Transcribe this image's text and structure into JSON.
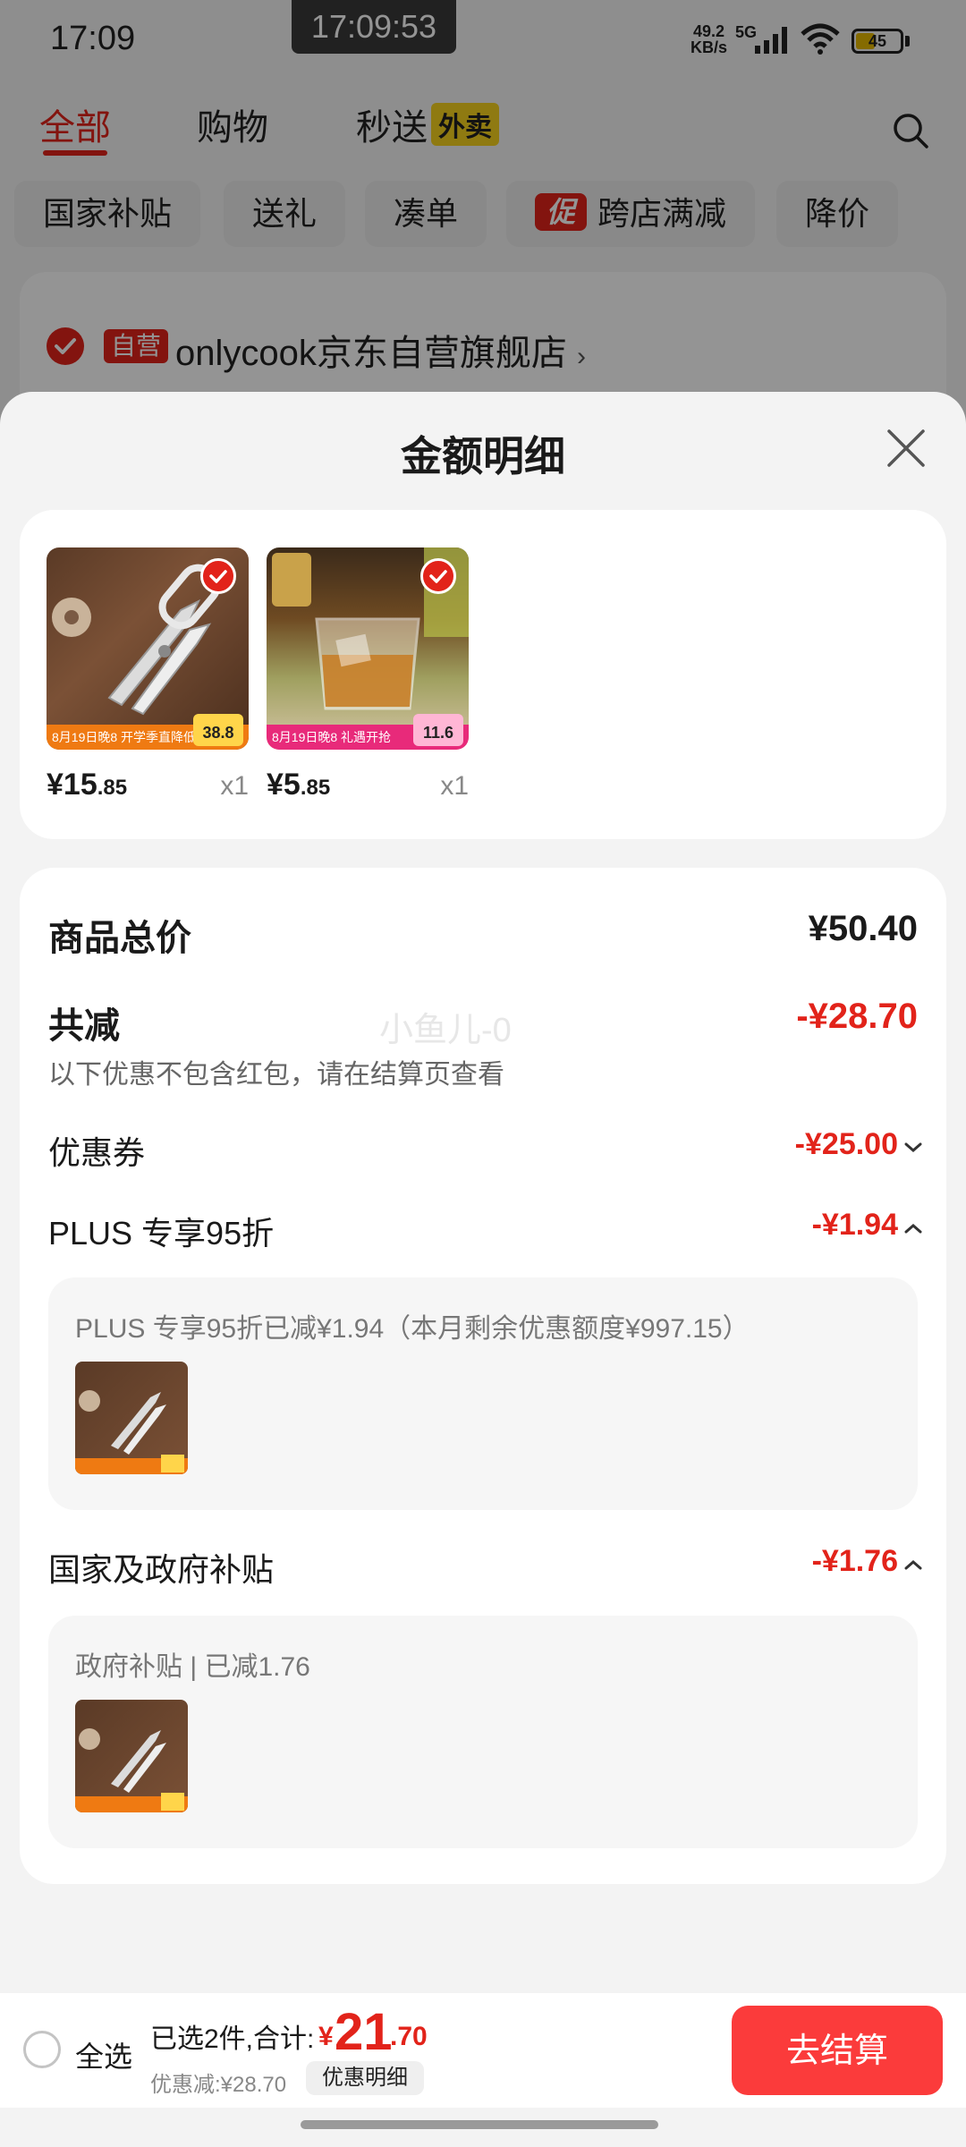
{
  "status_bar": {
    "time": "17:09",
    "clock": "17:09:53",
    "net_speed_value": "49.2",
    "net_speed_unit": "KB/s",
    "network": "5G",
    "battery": "45"
  },
  "top_tabs": {
    "all": "全部",
    "shopping": "购物",
    "instant": "秒送",
    "takeout_badge": "外卖"
  },
  "chips": [
    "国家补贴",
    "送礼",
    "凑单",
    "跨店满减",
    "降价"
  ],
  "chip_promo_badge": "促",
  "store": {
    "self_badge": "自营",
    "name": "onlycook京东自营旗舰店",
    "chevron": "›"
  },
  "sheet": {
    "title": "金额明细"
  },
  "products": [
    {
      "price_symbol": "¥",
      "price_int": "15",
      "price_dec": ".85",
      "qty": "x1",
      "promo_bar": "8月19日晚8 开学季直降低价",
      "tag_price": "38.8",
      "icon": "kitchen-scissors"
    },
    {
      "price_symbol": "¥",
      "price_int": "5",
      "price_dec": ".85",
      "qty": "x1",
      "promo_bar": "8月19日晚8 礼遇开抢",
      "tag_price": "11.6",
      "icon": "whisky-glass"
    }
  ],
  "details": {
    "total_label": "商品总价",
    "total_value": "¥50.40",
    "reduction_label": "共减",
    "reduction_value": "-¥28.70",
    "reduction_note": "以下优惠不包含红包，请在结算页查看",
    "coupon_label": "优惠券",
    "coupon_value": "-¥25.00",
    "plus_label": "PLUS 专享95折",
    "plus_value": "-¥1.94",
    "plus_desc": "PLUS 专享95折已减¥1.94（本月剩余优惠额度¥997.15）",
    "gov_label": "国家及政府补贴",
    "gov_value": "-¥1.76",
    "gov_desc": "政府补贴 | 已减1.76"
  },
  "watermark": "小鱼儿-0",
  "bottom_bar": {
    "select_all": "全选",
    "selected_summary": "已选2件,合计:",
    "total_symbol": "¥",
    "total_int": "21",
    "total_dec": ".70",
    "discount_summary": "优惠减:¥28.70",
    "detail_button": "优惠明细",
    "checkout_button": "去结算"
  },
  "colors": {
    "accent_red": "#e2231a",
    "checkout_red": "#fb3b3b",
    "takeout_yellow": "#f7d21e"
  }
}
